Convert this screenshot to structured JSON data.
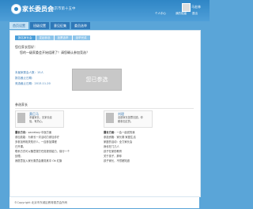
{
  "header": {
    "title": "家长委员会",
    "subtitle": "北京市第十五中",
    "user_name": "马宏林",
    "links": [
      "个人中心",
      "我的班级",
      "退出"
    ]
  },
  "nav": {
    "tabs": [
      "首页设置",
      "班级设置",
      "意见征集",
      "委员选举"
    ]
  },
  "steps": [
    "报名家长会",
    "发起参选",
    "投票选举",
    "选举完成"
  ],
  "greeting": "您位家长您好：",
  "question": "您的一级家委会开始组建了！请您确认参加竞选？",
  "info_lines": [
    "本届家委会人数：15人",
    "报名截止日期：",
    "竞选截止日期：2013-11-20"
  ],
  "join_button": "您已参选",
  "members_heading": "参选家长",
  "members": [
    {
      "name": "黄巨马",
      "desc": "本届家长，无家长经验，有热心。",
      "features": [
        {
          "label": "擅长方向：",
          "value": "secretary·中医方面"
        },
        {
          "label": "",
          "value": "参加技能：为家长一次活动力参加诊疗"
        },
        {
          "label": "",
          "value": "多参加有相关知识人，一应参加课程"
        },
        {
          "label": "",
          "value": "已开课。"
        },
        {
          "label": "",
          "value": "联系方式可以随意拨打任务提供能力，保行一个"
        },
        {
          "label": "",
          "value": "处理。"
        },
        {
          "label": "",
          "value": "我愿意加入家长委员会服务其中 Ok 红旗"
        }
      ]
    },
    {
      "name": "刘理",
      "desc": "全部家长投票社团，你都参加过的。",
      "features": [
        {
          "label": "擅长方面：",
          "value": "一会一起说的我"
        },
        {
          "label": "",
          "value": "参选资格：家长委 家庭生活"
        },
        {
          "label": "",
          "value": "家庭的活动：全力家长会"
        },
        {
          "label": "",
          "value": "我也在门几人"
        },
        {
          "label": "",
          "value": "孩子在家的教育"
        },
        {
          "label": "",
          "value": "关于孩子，那你"
        },
        {
          "label": "",
          "value": "孩子家长，不然都知道"
        }
      ]
    }
  ],
  "footer": "©Copyright 北京市东城区教育委员会所有"
}
